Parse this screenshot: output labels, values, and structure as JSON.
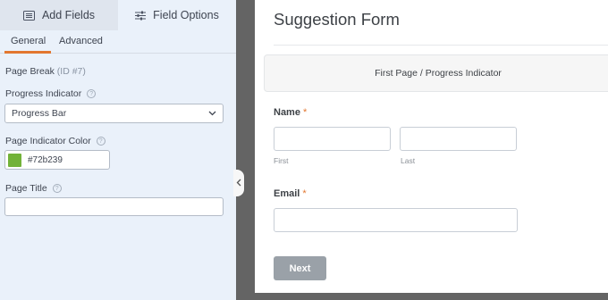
{
  "panel": {
    "tabs": [
      {
        "label": "Add Fields",
        "icon": "list-icon"
      },
      {
        "label": "Field Options",
        "icon": "sliders-icon"
      }
    ],
    "subtabs": {
      "general": "General",
      "advanced": "Advanced"
    },
    "field": {
      "name": "Page Break",
      "id": "(ID #7)"
    },
    "progress_indicator": {
      "label": "Progress Indicator",
      "value": "Progress Bar"
    },
    "indicator_color": {
      "label": "Page Indicator Color",
      "value": "#72b239"
    },
    "page_title": {
      "label": "Page Title",
      "value": ""
    },
    "help_glyph": "?"
  },
  "preview": {
    "form_title": "Suggestion Form",
    "page_break_label": "First Page / Progress Indicator",
    "name_field": {
      "label": "Name",
      "required_mark": "*",
      "first_label": "First",
      "last_label": "Last"
    },
    "email_field": {
      "label": "Email",
      "required_mark": "*"
    },
    "next_button": "Next"
  },
  "colors": {
    "accent": "#e27730",
    "indicator": "#72b239",
    "button": "#9aa1a8",
    "panel_bg": "#eaf1fa"
  }
}
